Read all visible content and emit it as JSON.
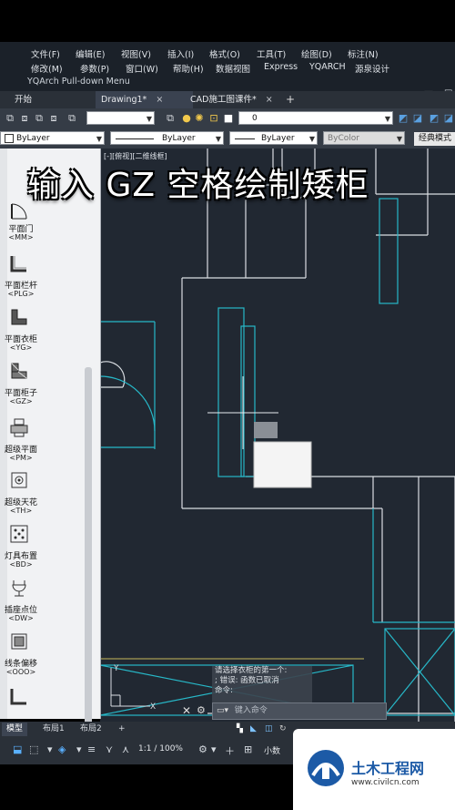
{
  "menu": {
    "row1": [
      "文件(F)",
      "编辑(E)",
      "视图(V)",
      "插入(I)",
      "格式(O)",
      "工具(T)",
      "绘图(D)",
      "标注(N)"
    ],
    "row2": [
      "修改(M)",
      "参数(P)",
      "窗口(W)",
      "帮助(H)",
      "数据视图",
      "Express",
      "YQARCH",
      "源泉设计"
    ],
    "plugin": "YQArch Pull-down Menu"
  },
  "tabs": {
    "start": "开始",
    "drawing": "Drawing1*",
    "cad": "CAD施工图课件*",
    "add": "+",
    "close": "×"
  },
  "toolbar": {
    "layer_value": "0",
    "color_value": "ByLayer",
    "linetype_value": "ByLayer",
    "lineweight_value": "ByLayer",
    "plotstyle_value": "ByColor",
    "workspace": "经典模式"
  },
  "viewport_label": "[-][俯视][二维线框]",
  "caption": "输入 GZ 空格绘制矮柜",
  "palette": {
    "items": [
      {
        "label": "平面门",
        "code": "<MM>"
      },
      {
        "label": "平面栏杆",
        "code": "<PLG>"
      },
      {
        "label": "平面衣柜",
        "code": "<YG>"
      },
      {
        "label": "平面柜子",
        "code": "<GZ>"
      },
      {
        "label": "超级平面",
        "code": "<PM>"
      },
      {
        "label": "超级天花",
        "code": "<TH>"
      },
      {
        "label": "灯具布置",
        "code": "<BD>"
      },
      {
        "label": "插座点位",
        "code": "<DW>"
      },
      {
        "label": "线条偏移",
        "code": "<OOO>"
      }
    ]
  },
  "command": {
    "history_1": "请选择衣柜的第一个:",
    "history_2": "; 错误: 函数已取消",
    "history_3": "命令:",
    "placeholder": "键入命令"
  },
  "layout_tabs": {
    "model": "模型",
    "layout1": "布局1",
    "layout2": "布局2",
    "add": "+"
  },
  "status": {
    "scale": "1:1 / 100%",
    "units": "小数"
  },
  "watermark": {
    "title": "土木工程网",
    "url": "www.civilcn.com"
  },
  "colors": {
    "canvas": "#212832",
    "cyan_lines": "#27b8c8",
    "white_lines": "#d9dde2"
  }
}
